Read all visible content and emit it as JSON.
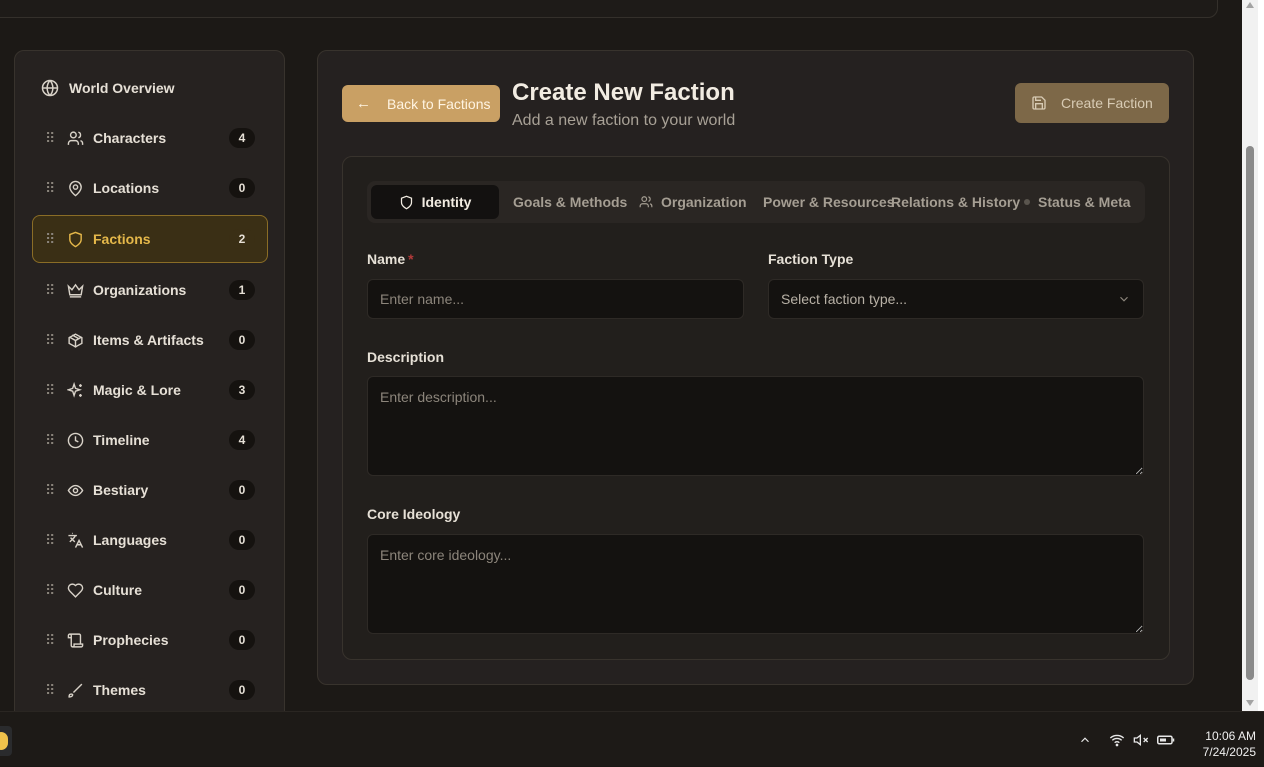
{
  "sidebar": {
    "overview_label": "World Overview",
    "items": [
      {
        "label": "Characters",
        "count": "4",
        "icon": "users-icon"
      },
      {
        "label": "Locations",
        "count": "0",
        "icon": "map-pin-icon"
      },
      {
        "label": "Factions",
        "count": "2",
        "icon": "shield-icon"
      },
      {
        "label": "Organizations",
        "count": "1",
        "icon": "crown-icon"
      },
      {
        "label": "Items & Artifacts",
        "count": "0",
        "icon": "package-icon"
      },
      {
        "label": "Magic & Lore",
        "count": "3",
        "icon": "sparkles-icon"
      },
      {
        "label": "Timeline",
        "count": "4",
        "icon": "clock-icon"
      },
      {
        "label": "Bestiary",
        "count": "0",
        "icon": "eye-icon"
      },
      {
        "label": "Languages",
        "count": "0",
        "icon": "languages-icon"
      },
      {
        "label": "Culture",
        "count": "0",
        "icon": "heart-icon"
      },
      {
        "label": "Prophecies",
        "count": "0",
        "icon": "scroll-icon"
      },
      {
        "label": "Themes",
        "count": "0",
        "icon": "brush-icon"
      }
    ]
  },
  "header": {
    "back_label": "Back to Factions",
    "title": "Create New Faction",
    "subtitle": "Add a new faction to your world",
    "create_label": "Create Faction"
  },
  "tabs": [
    {
      "label": "Identity"
    },
    {
      "label": "Goals & Methods"
    },
    {
      "label": "Organization"
    },
    {
      "label": "Power & Resources"
    },
    {
      "label": "Relations & History"
    },
    {
      "label": "Status & Meta"
    }
  ],
  "form": {
    "name_label": "Name",
    "name_required": "*",
    "name_placeholder": "Enter name...",
    "type_label": "Faction Type",
    "type_placeholder": "Select faction type...",
    "description_label": "Description",
    "description_placeholder": "Enter description...",
    "ideology_label": "Core Ideology",
    "ideology_placeholder": "Enter core ideology..."
  },
  "taskbar": {
    "time": "10:06 AM",
    "date": "7/24/2025"
  },
  "colors": {
    "accent": "#e5b84a",
    "back_button": "#c9a064",
    "create_button": "#7d6848",
    "required": "#b33a3a"
  }
}
